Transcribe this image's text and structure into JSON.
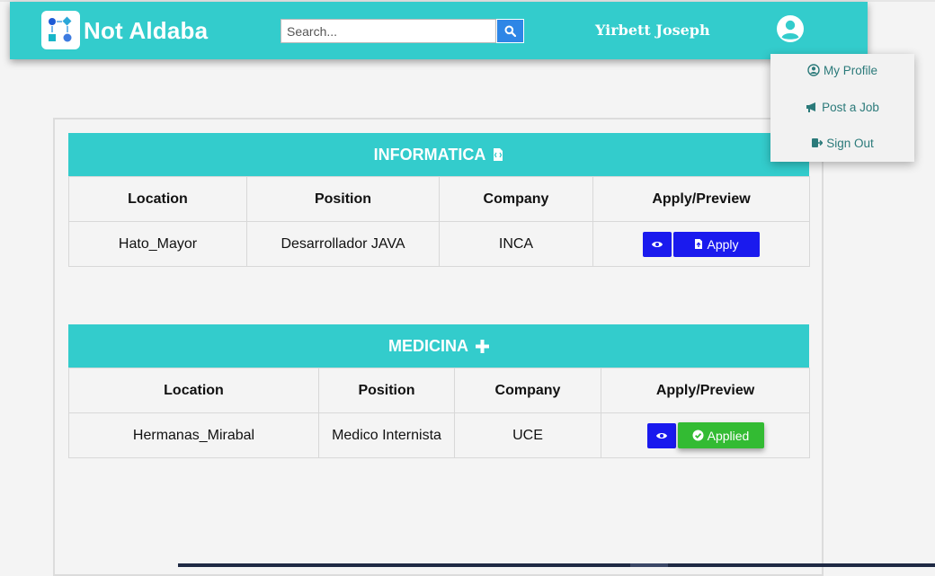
{
  "brand": {
    "name": "Not Aldaba",
    "logo_icon": "flowchart-logo-icon"
  },
  "search": {
    "placeholder": "Search...",
    "value": "",
    "icon": "search-icon"
  },
  "user": {
    "name": "Yirbett Joseph",
    "avatar_icon": "user-circle-icon"
  },
  "dropdown": {
    "items": [
      {
        "label": "My Profile",
        "icon": "user-circle-icon"
      },
      {
        "label": "Post a Job",
        "icon": "megaphone-icon"
      },
      {
        "label": "Sign Out",
        "icon": "sign-out-icon"
      }
    ]
  },
  "table_headers": {
    "location": "Location",
    "position": "Position",
    "company": "Company",
    "action": "Apply/Preview"
  },
  "sections": [
    {
      "title": "INFORMATICA",
      "icon": "code-file-icon",
      "rows": [
        {
          "location": "Hato_Mayor",
          "position": "Desarrollador JAVA",
          "company": "INCA",
          "action_label": "Apply",
          "status": "apply"
        }
      ]
    },
    {
      "title": "MEDICINA",
      "icon": "plus-icon",
      "rows": [
        {
          "location": "Hermanas_Mirabal",
          "position": "Medico Internista",
          "company": "UCE",
          "action_label": "Applied",
          "status": "applied"
        }
      ]
    }
  ],
  "colors": {
    "accent": "#33cccc",
    "primary_button": "#1a1aee",
    "success_button": "#33bb33",
    "dropdown_text": "#2b7a7a"
  }
}
